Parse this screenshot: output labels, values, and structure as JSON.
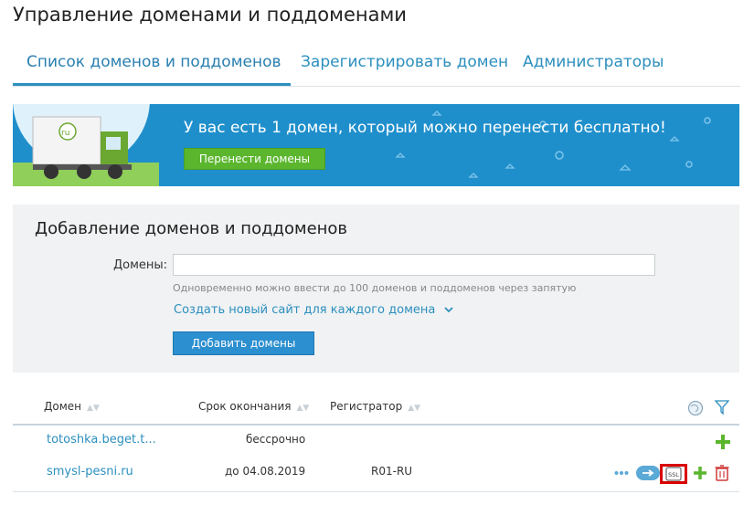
{
  "title": "Управление доменами и поддоменами",
  "tabs": [
    {
      "label": "Список доменов и поддоменов"
    },
    {
      "label": "Зарегистрировать домен"
    },
    {
      "label": "Администраторы"
    }
  ],
  "banner": {
    "text": "У вас есть 1 домен, который можно перенести бесплатно!",
    "button": "Перенести домены",
    "truck_logo": "ru"
  },
  "add_panel": {
    "title": "Добавление доменов и поддоменов",
    "domains_label": "Домены:",
    "domains_value": "",
    "hint": "Одновременно можно ввести до 100 доменов и поддоменов через запятую",
    "create_link": "Создать новый сайт для каждого домена",
    "add_button": "Добавить домены"
  },
  "table": {
    "columns": [
      "Домен",
      "Срок окончания",
      "Регистратор"
    ],
    "rows": [
      {
        "domain": "totoshka.beget.t...",
        "expires": "бессрочно",
        "registrar": ""
      },
      {
        "domain": "smysl-pesni.ru",
        "expires": "до 04.08.2019",
        "registrar": "R01-RU",
        "ssl_label": "SSL"
      }
    ]
  },
  "colors": {
    "accent": "#2c8fbe",
    "banner_bg": "#1f8fcc",
    "green_button": "#5bb62e",
    "add_icon": "#5bb62e",
    "delete_icon": "#d03a3a",
    "highlight_box": "#d90000"
  }
}
